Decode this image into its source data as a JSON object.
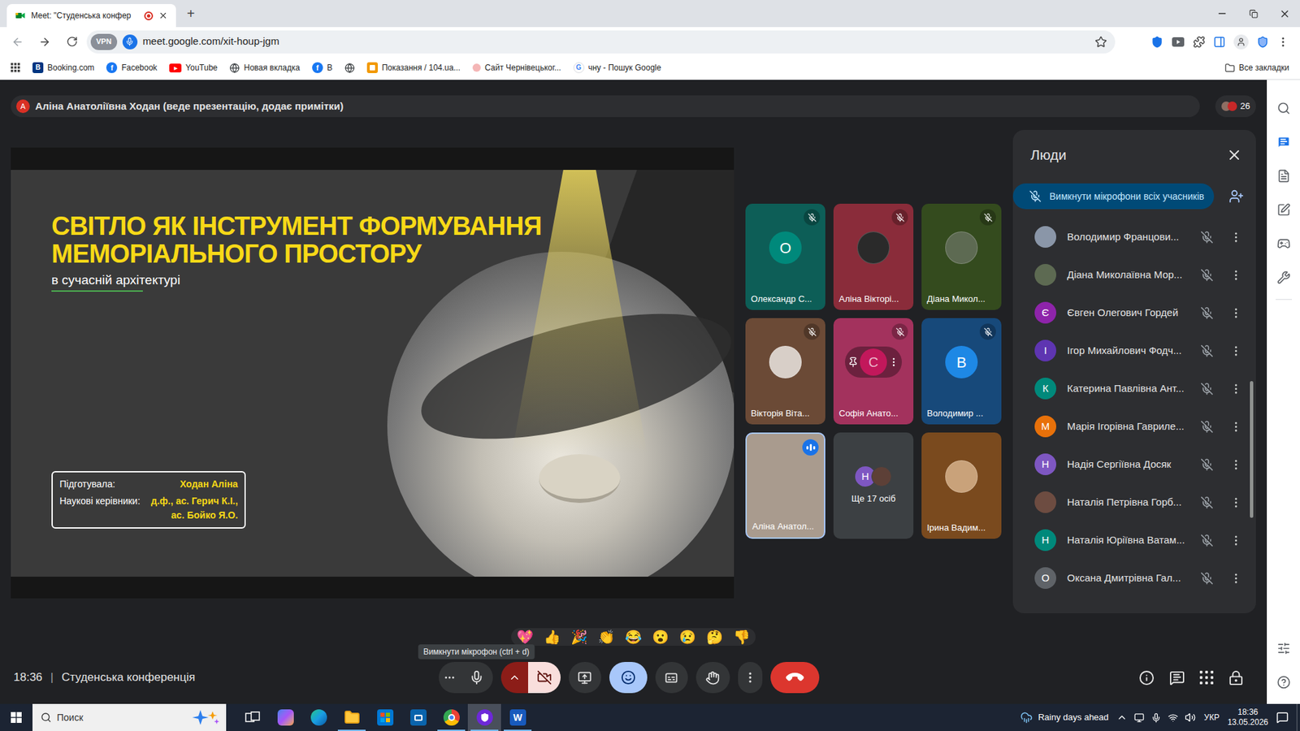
{
  "browser": {
    "tab": {
      "title": "Meet: \"Студенська конфер",
      "recording": true,
      "selected": true
    },
    "new_tab": "+",
    "address": {
      "vpn": "VPN",
      "url": "meet.google.com/xit-houp-jgm",
      "bookmarked": false
    },
    "bookmarks": [
      {
        "label": "Booking.com",
        "kind": "letter",
        "glyph": "B",
        "color": "#003580"
      },
      {
        "label": "Facebook",
        "kind": "round",
        "glyph": "f",
        "color": "#1877f2"
      },
      {
        "label": "YouTube",
        "kind": "play",
        "glyph": "▶",
        "color": "#ff0000"
      },
      {
        "label": "Новая вкладка",
        "kind": "globe",
        "color": "#3c4043"
      },
      {
        "label": "В",
        "kind": "round",
        "glyph": "f",
        "color": "#1877f2"
      },
      {
        "kind": "globe",
        "color": "#3c4043"
      },
      {
        "label": "Показання / 104.ua...",
        "kind": "square",
        "color": "#f29900"
      },
      {
        "label": "Сайт Чернівецьког...",
        "kind": "dot",
        "color": "#f4b6b6"
      },
      {
        "label": "чну - Пошук Google",
        "kind": "google",
        "glyph": "G",
        "color": "#4285f4"
      }
    ],
    "all_bookmarks": "Все закладки"
  },
  "meet": {
    "banner": {
      "avatar": "А",
      "avatar_color": "#d93025",
      "text": "Аліна Анатоліївна Ходан (веде презентацію, додає примітки)"
    },
    "participants": {
      "count": "26"
    },
    "slide": {
      "title_lines": [
        "СВІТЛО ЯК ІНСТРУМЕНТ ФОРМУВАННЯ",
        "МЕМОРІАЛЬНОГО ПРОСТОРУ"
      ],
      "subtitle": "в сучасній архітектурі",
      "credits": [
        {
          "label": "Підготувала:",
          "values": [
            "Ходан Аліна"
          ]
        },
        {
          "label": "Наукові керівники:",
          "values": [
            "д.ф., ас. Герич К.І.,",
            "ас. Бойко Я.О."
          ]
        }
      ]
    },
    "tiles": [
      {
        "name": "Олександр С...",
        "kind": "letter",
        "initial": "О",
        "bg": "#0d5e57",
        "avatar_color": "#00897b",
        "muted": true,
        "speaking": false,
        "hovered": false
      },
      {
        "name": "Аліна Вікторі...",
        "kind": "photo",
        "bg": "#8a2c3a",
        "avatar_color": "#2a2a2a",
        "muted": true,
        "speaking": false,
        "hovered": false
      },
      {
        "name": "Діана Микол...",
        "kind": "photo",
        "bg": "#344b1e",
        "avatar_color": "#5d6a52",
        "muted": true,
        "speaking": false,
        "hovered": false
      },
      {
        "name": "Вікторія Віта...",
        "kind": "photo",
        "bg": "#6b4a36",
        "avatar_color": "#d8cfc8",
        "muted": true,
        "speaking": false,
        "hovered": false
      },
      {
        "name": "Софія Анато...",
        "kind": "letter",
        "initial": "С",
        "bg": "#a3325d",
        "avatar_color": "#c2185b",
        "muted": true,
        "speaking": false,
        "hovered": true
      },
      {
        "name": "Володимир ...",
        "kind": "letter",
        "initial": "В",
        "bg": "#17497a",
        "avatar_color": "#1e88e5",
        "muted": true,
        "speaking": false,
        "hovered": false
      },
      {
        "name": "Аліна Анатол...",
        "kind": "video",
        "bg": "#a99b8e",
        "muted": false,
        "speaking": true,
        "hovered": false
      },
      {
        "name": "Ще 17 осіб",
        "kind": "more",
        "initial": "Н",
        "bg": "#3c4043",
        "avatar_color": "#7e57c2",
        "muted": false,
        "speaking": false,
        "hovered": false
      },
      {
        "name": "Ірина Вадим...",
        "kind": "photo",
        "bg": "#7a4a1e",
        "avatar_color": "#c9a27a",
        "muted": false,
        "speaking": false,
        "hovered": false
      }
    ],
    "people": {
      "title": "Люди",
      "mute_all": "Вимкнути мікрофони всіх учасників",
      "list": [
        {
          "name": "Володимир Францови...",
          "kind": "photo",
          "color": "#8a96a8",
          "muted": true
        },
        {
          "name": "Діана Миколаївна Мор...",
          "kind": "photo",
          "color": "#5d6a52",
          "muted": true
        },
        {
          "name": "Євген Олегович Гордей",
          "kind": "letter",
          "initial": "Є",
          "color": "#8e24aa",
          "muted": true
        },
        {
          "name": "Ігор Михайлович Фодч...",
          "kind": "letter",
          "initial": "І",
          "color": "#5e35b1",
          "muted": true
        },
        {
          "name": "Катерина Павлівна Ант...",
          "kind": "letter",
          "initial": "К",
          "color": "#00897b",
          "muted": true
        },
        {
          "name": "Марія Ігорівна Гавриле...",
          "kind": "letter",
          "initial": "М",
          "color": "#e8710a",
          "muted": true
        },
        {
          "name": "Надія Сергіївна Досяк",
          "kind": "letter",
          "initial": "Н",
          "color": "#7e57c2",
          "muted": true
        },
        {
          "name": "Наталія Петрівна Горб...",
          "kind": "photo",
          "color": "#6d4c41",
          "muted": true
        },
        {
          "name": "Наталія Юріївна Ватам...",
          "kind": "letter",
          "initial": "Н",
          "color": "#00897b",
          "muted": true
        },
        {
          "name": "Оксана Дмитрівна Гал...",
          "kind": "letter",
          "initial": "О",
          "color": "#5f6368",
          "muted": true
        }
      ]
    },
    "reactions": [
      "💖",
      "👍",
      "🎉",
      "👏",
      "😂",
      "😮",
      "😢",
      "🤔",
      "👎"
    ],
    "tooltip": "Вимкнути мікрофон (ctrl + d)",
    "footer": {
      "time": "18:36",
      "separator": "|",
      "meeting": "Студенська конференція"
    },
    "controls": {
      "mic": {
        "muted": false
      },
      "camera": {
        "off": true
      },
      "reactions": {
        "selected": true
      },
      "captions": {
        "selected": false
      },
      "hand": {
        "selected": false
      }
    },
    "sidebar": {
      "top": [
        {
          "kind": "search",
          "selected": false
        },
        {
          "kind": "chat",
          "selected": true
        },
        {
          "kind": "notes",
          "selected": false
        },
        {
          "kind": "edit",
          "selected": false
        },
        {
          "kind": "games",
          "selected": false
        },
        {
          "kind": "tools",
          "selected": false
        }
      ],
      "bottom": [
        {
          "kind": "settings",
          "selected": false
        },
        {
          "kind": "help",
          "selected": false
        }
      ]
    }
  },
  "taskbar": {
    "search": "Поиск",
    "apps": [
      {
        "kind": "taskview",
        "open": false,
        "active": false
      },
      {
        "kind": "copilot",
        "open": false,
        "active": false
      },
      {
        "kind": "edge",
        "open": false,
        "active": false
      },
      {
        "kind": "explorer",
        "open": true,
        "active": false
      },
      {
        "kind": "store",
        "open": false,
        "active": false
      },
      {
        "kind": "outlook",
        "open": false,
        "active": false
      },
      {
        "kind": "chrome",
        "open": true,
        "active": false
      },
      {
        "kind": "vpn",
        "open": true,
        "active": true
      },
      {
        "kind": "word",
        "open": true,
        "active": false,
        "glyph": "W"
      }
    ],
    "weather": "Rainy days ahead",
    "language": "УКР",
    "time": "18:36",
    "date": "13.05.2026"
  }
}
